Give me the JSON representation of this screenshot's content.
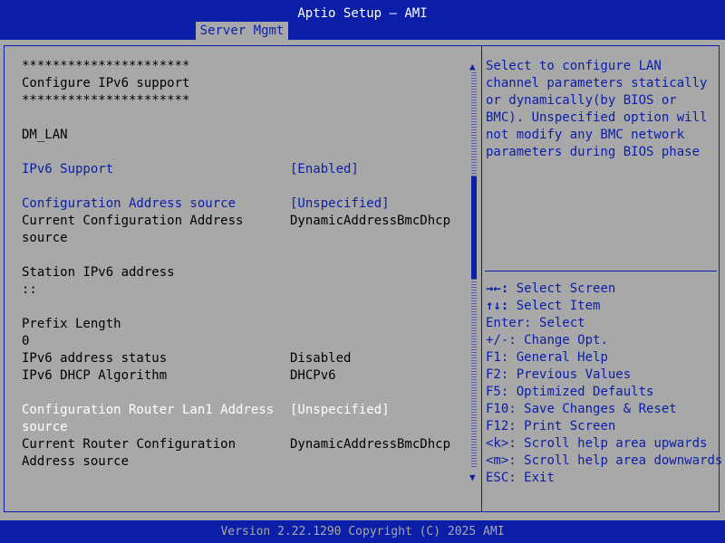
{
  "header": {
    "title": "Aptio Setup – AMI",
    "active_tab": "Server Mgmt"
  },
  "footer": {
    "version": "Version 2.22.1290 Copyright (C) 2025 AMI"
  },
  "colors": {
    "background": "#a8a8a8",
    "accent": "#0b1ea8",
    "highlight": "#ffffff"
  },
  "main": {
    "rows": [
      {
        "label": "**********************",
        "value": ""
      },
      {
        "label": "Configure IPv6 support",
        "value": ""
      },
      {
        "label": "**********************",
        "value": ""
      },
      {
        "label": "",
        "value": ""
      },
      {
        "label": "DM_LAN",
        "value": ""
      },
      {
        "label": "",
        "value": ""
      },
      {
        "label": "IPv6 Support",
        "value": "[Enabled]"
      },
      {
        "label": "",
        "value": ""
      },
      {
        "label": "Configuration Address source",
        "value": "[Unspecified]"
      },
      {
        "label": "Current Configuration Address",
        "value": "DynamicAddressBmcDhcp"
      },
      {
        "label": "source",
        "value": ""
      },
      {
        "label": "",
        "value": ""
      },
      {
        "label": "Station IPv6 address",
        "value": ""
      },
      {
        "label": "::",
        "value": ""
      },
      {
        "label": "",
        "value": ""
      },
      {
        "label": "Prefix Length",
        "value": ""
      },
      {
        "label": "0",
        "value": ""
      },
      {
        "label": "IPv6 address status",
        "value": "Disabled"
      },
      {
        "label": "IPv6 DHCP Algorithm",
        "value": "DHCPv6"
      },
      {
        "label": "",
        "value": ""
      },
      {
        "label": "Configuration Router Lan1 Address",
        "value": "[Unspecified]"
      },
      {
        "label": "source",
        "value": ""
      },
      {
        "label": "Current Router Configuration",
        "value": "DynamicAddressBmcDhcp"
      },
      {
        "label": "Address source",
        "value": ""
      }
    ]
  },
  "help": {
    "lines": [
      "Select to configure LAN",
      "channel parameters statically",
      "or dynamically(by BIOS or",
      "BMC). Unspecified option will",
      "not modify any BMC network",
      "parameters during BIOS phase"
    ]
  },
  "keys": [
    {
      "key": "→←:",
      "action": "Select Screen",
      "bold": true
    },
    {
      "key": "↑↓:",
      "action": "Select Item",
      "bold": true
    },
    {
      "key": "Enter:",
      "action": "Select",
      "bold": false
    },
    {
      "key": "+/-:",
      "action": "Change Opt.",
      "bold": false
    },
    {
      "key": "F1:",
      "action": "General Help",
      "bold": false
    },
    {
      "key": "F2:",
      "action": "Previous Values",
      "bold": false
    },
    {
      "key": "F5:",
      "action": "Optimized Defaults",
      "bold": false
    },
    {
      "key": "F10:",
      "action": "Save Changes & Reset",
      "bold": false
    },
    {
      "key": "F12:",
      "action": "Print Screen",
      "bold": false
    },
    {
      "key": "<k>:",
      "action": "Scroll help area upwards",
      "bold": false
    },
    {
      "key": "<m>:",
      "action": "Scroll help area downwards",
      "bold": false
    },
    {
      "key": "ESC:",
      "action": "Exit",
      "bold": false
    }
  ],
  "scroll": {
    "up_icon": "▲",
    "down_icon": "▼"
  }
}
